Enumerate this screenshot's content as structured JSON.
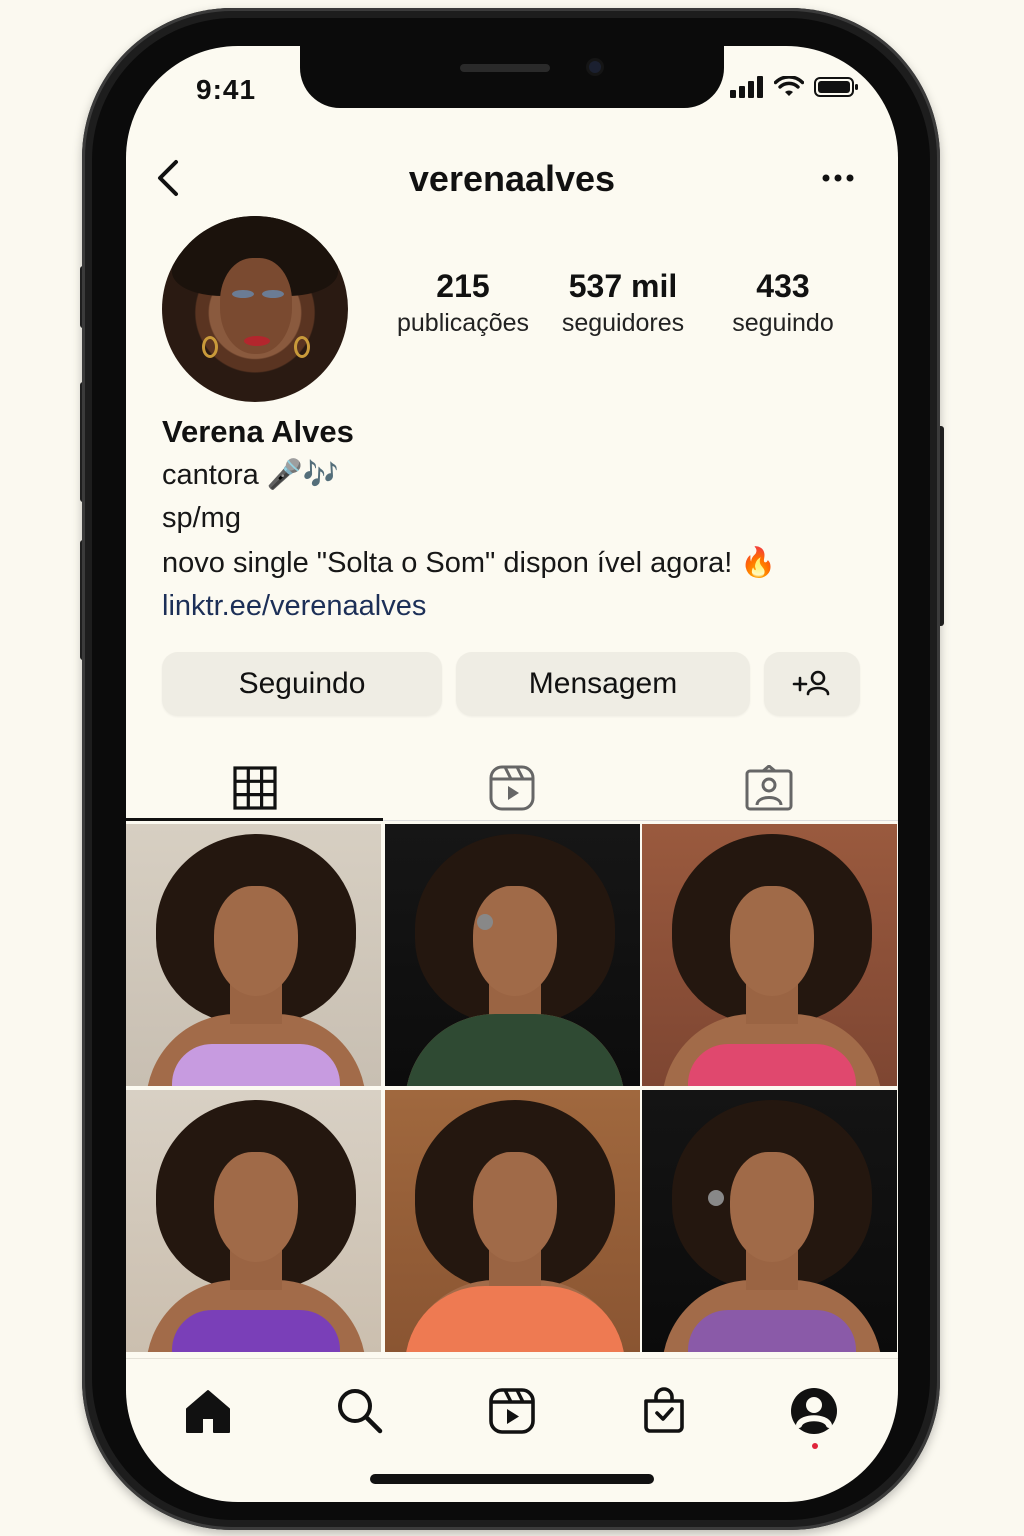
{
  "status_bar": {
    "time": "9:41",
    "icons": [
      "signal-icon",
      "wifi-icon",
      "battery-icon"
    ]
  },
  "header": {
    "username": "verenaalves",
    "back_icon": "chevron-left-icon",
    "more_icon": "more-horizontal-icon"
  },
  "profile": {
    "stats": [
      {
        "value": "215",
        "label": "publicações"
      },
      {
        "value": "537 mil",
        "label": "seguidores"
      },
      {
        "value": "433",
        "label": "seguindo"
      }
    ],
    "bio": {
      "name": "Verena Alves",
      "line1": "cantora 🎤🎶",
      "line2": "sp/mg",
      "line3": "novo single \"Solta o Som\" dispon ível agora! 🔥",
      "link": "linktr.ee/verenaalves"
    },
    "buttons": {
      "following": "Seguindo",
      "message": "Mensagem",
      "add_user_icon": "add-user-icon"
    }
  },
  "tabs": [
    {
      "name": "posts",
      "icon": "grid-icon",
      "active": true
    },
    {
      "name": "reels",
      "icon": "reels-icon",
      "active": false
    },
    {
      "name": "tagged",
      "icon": "tagged-icon",
      "active": false
    }
  ],
  "posts_count_visible": 6,
  "bottom_nav": [
    {
      "name": "home",
      "icon": "home-icon"
    },
    {
      "name": "search",
      "icon": "search-icon"
    },
    {
      "name": "reels",
      "icon": "reels-icon"
    },
    {
      "name": "shop",
      "icon": "shop-icon"
    },
    {
      "name": "profile",
      "icon": "profile-icon"
    }
  ],
  "colors": {
    "background": "#fcfaf1",
    "link": "#1c2f57",
    "button_bg": "#efede4",
    "notification_dot": "#e0243a"
  }
}
